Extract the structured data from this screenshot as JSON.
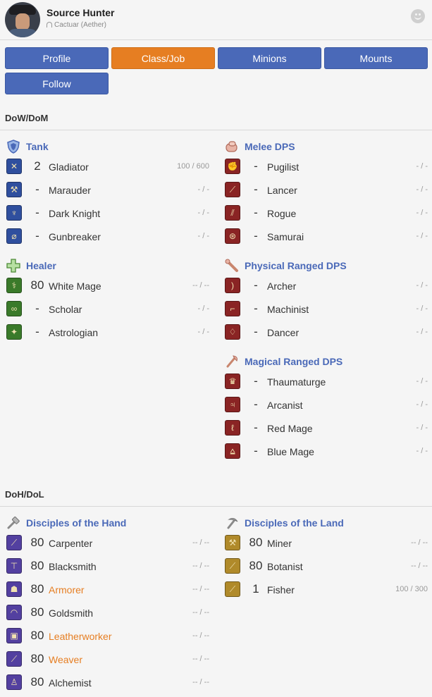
{
  "header": {
    "character_name": "Source Hunter",
    "server": "Cactuar (Aether)"
  },
  "tabs": [
    {
      "label": "Profile"
    },
    {
      "label": "Class/Job"
    },
    {
      "label": "Minions"
    },
    {
      "label": "Mounts"
    },
    {
      "label": "Follow"
    }
  ],
  "sections": {
    "dow_dom": "DoW/DoM",
    "doh_dol": "DoH/DoL"
  },
  "roles": {
    "tank": {
      "label": "Tank",
      "jobs": [
        {
          "name": "Gladiator",
          "level": "2",
          "exp": "100 / 600",
          "icon": "sword-shield-icon"
        },
        {
          "name": "Marauder",
          "level": "-",
          "exp": "- / -",
          "icon": "axe-icon"
        },
        {
          "name": "Dark Knight",
          "level": "-",
          "exp": "- / -",
          "icon": "dark-knight-icon"
        },
        {
          "name": "Gunbreaker",
          "level": "-",
          "exp": "- / -",
          "icon": "gunblade-icon"
        }
      ]
    },
    "melee": {
      "label": "Melee DPS",
      "jobs": [
        {
          "name": "Pugilist",
          "level": "-",
          "exp": "- / -",
          "icon": "fist-icon"
        },
        {
          "name": "Lancer",
          "level": "-",
          "exp": "- / -",
          "icon": "lance-icon"
        },
        {
          "name": "Rogue",
          "level": "-",
          "exp": "- / -",
          "icon": "daggers-icon"
        },
        {
          "name": "Samurai",
          "level": "-",
          "exp": "- / -",
          "icon": "samurai-icon"
        }
      ]
    },
    "healer": {
      "label": "Healer",
      "jobs": [
        {
          "name": "White Mage",
          "level": "80",
          "exp": "-- / --",
          "icon": "white-mage-icon"
        },
        {
          "name": "Scholar",
          "level": "-",
          "exp": "- / -",
          "icon": "scholar-icon"
        },
        {
          "name": "Astrologian",
          "level": "-",
          "exp": "- / -",
          "icon": "astrologian-icon"
        }
      ]
    },
    "phys_ranged": {
      "label": "Physical Ranged DPS",
      "jobs": [
        {
          "name": "Archer",
          "level": "-",
          "exp": "- / -",
          "icon": "bow-icon"
        },
        {
          "name": "Machinist",
          "level": "-",
          "exp": "- / -",
          "icon": "gun-icon"
        },
        {
          "name": "Dancer",
          "level": "-",
          "exp": "- / -",
          "icon": "dancer-icon"
        }
      ]
    },
    "mag_ranged": {
      "label": "Magical Ranged DPS",
      "jobs": [
        {
          "name": "Thaumaturge",
          "level": "-",
          "exp": "- / -",
          "icon": "thaumaturge-icon"
        },
        {
          "name": "Arcanist",
          "level": "-",
          "exp": "- / -",
          "icon": "arcanist-icon"
        },
        {
          "name": "Red Mage",
          "level": "-",
          "exp": "- / -",
          "icon": "red-mage-icon"
        },
        {
          "name": "Blue Mage",
          "level": "-",
          "exp": "- / -",
          "icon": "blue-mage-icon"
        }
      ]
    },
    "hand": {
      "label": "Disciples of the Hand",
      "jobs": [
        {
          "name": "Carpenter",
          "level": "80",
          "exp": "-- / --",
          "icon": "saw-icon",
          "highlight": false
        },
        {
          "name": "Blacksmith",
          "level": "80",
          "exp": "-- / --",
          "icon": "anvil-icon",
          "highlight": false
        },
        {
          "name": "Armorer",
          "level": "80",
          "exp": "-- / --",
          "icon": "helmet-icon",
          "highlight": true
        },
        {
          "name": "Goldsmith",
          "level": "80",
          "exp": "-- / --",
          "icon": "ring-icon",
          "highlight": false
        },
        {
          "name": "Leatherworker",
          "level": "80",
          "exp": "-- / --",
          "icon": "leather-icon",
          "highlight": true
        },
        {
          "name": "Weaver",
          "level": "80",
          "exp": "-- / --",
          "icon": "needle-icon",
          "highlight": true
        },
        {
          "name": "Alchemist",
          "level": "80",
          "exp": "-- / --",
          "icon": "flask-icon",
          "highlight": false
        }
      ]
    },
    "land": {
      "label": "Disciples of the Land",
      "jobs": [
        {
          "name": "Miner",
          "level": "80",
          "exp": "-- / --",
          "icon": "pickaxe-icon"
        },
        {
          "name": "Botanist",
          "level": "80",
          "exp": "-- / --",
          "icon": "hatchet-icon"
        },
        {
          "name": "Fisher",
          "level": "1",
          "exp": "100 / 300",
          "icon": "fishing-rod-icon"
        }
      ]
    }
  },
  "colors": {
    "tab_default": "#4a69b8",
    "tab_active": "#e67e22",
    "role_label": "#4a69b8",
    "highlight_job": "#e67e22"
  }
}
